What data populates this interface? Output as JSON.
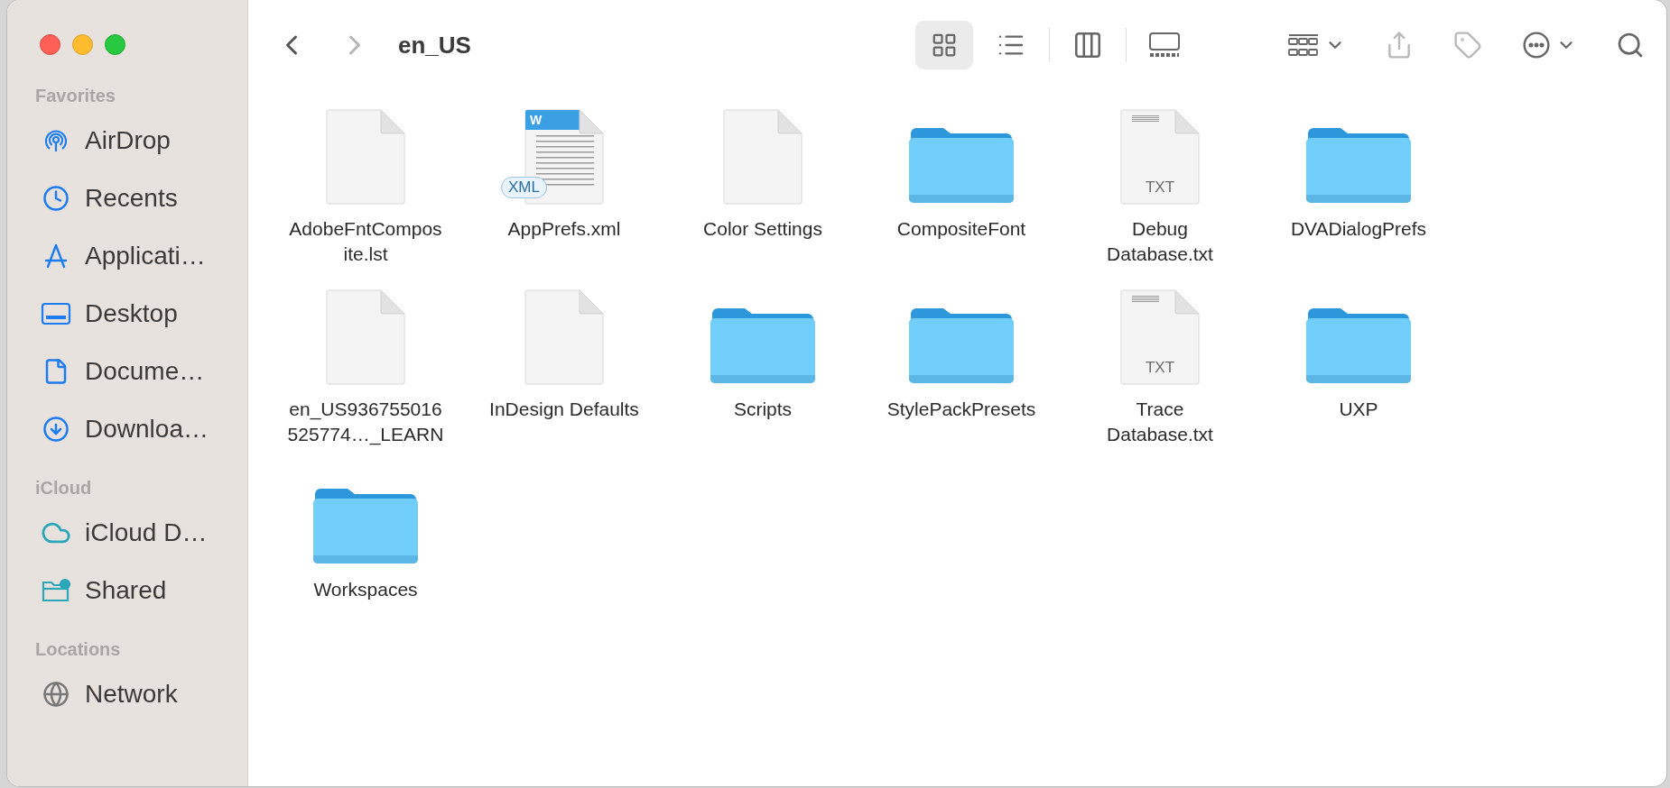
{
  "window": {
    "title": "en_US"
  },
  "toolbar": {
    "back": {
      "disabled": false
    },
    "forward": {
      "disabled": true
    },
    "view_buttons": [
      {
        "kind": "icons",
        "selected": true
      },
      {
        "kind": "list",
        "selected": false
      },
      {
        "kind": "columns",
        "selected": false
      },
      {
        "kind": "gallery",
        "selected": false
      }
    ],
    "actions": [
      {
        "kind": "group",
        "disabled": false
      },
      {
        "kind": "share",
        "disabled": true
      },
      {
        "kind": "tag",
        "disabled": true
      },
      {
        "kind": "more",
        "disabled": false
      },
      {
        "kind": "search",
        "disabled": false
      }
    ]
  },
  "sidebar": {
    "sections": [
      {
        "title": "Favorites",
        "items": [
          {
            "label": "AirDrop",
            "kind": "airdrop"
          },
          {
            "label": "Recents",
            "kind": "clock"
          },
          {
            "label": "Applicati…",
            "kind": "apps"
          },
          {
            "label": "Desktop",
            "kind": "desktop"
          },
          {
            "label": "Docume…",
            "kind": "document"
          },
          {
            "label": "Downloa…",
            "kind": "download"
          }
        ]
      },
      {
        "title": "iCloud",
        "items": [
          {
            "label": "iCloud D…",
            "kind": "cloud"
          },
          {
            "label": "Shared",
            "kind": "shared"
          }
        ]
      },
      {
        "title": "Locations",
        "items": [
          {
            "label": "Network",
            "kind": "globe"
          }
        ]
      }
    ]
  },
  "files": [
    {
      "kind": "document",
      "lines": [
        "AdobeFntCompos",
        "ite.lst"
      ]
    },
    {
      "kind": "xml",
      "badge": "XML",
      "corner_mark": "W",
      "lines": [
        "AppPrefs.xml"
      ]
    },
    {
      "kind": "document",
      "lines": [
        "Color Settings"
      ]
    },
    {
      "kind": "folder",
      "lines": [
        "CompositeFont"
      ]
    },
    {
      "kind": "txt",
      "badge": "TXT",
      "lines": [
        "Debug",
        "Database.txt"
      ]
    },
    {
      "kind": "folder",
      "lines": [
        "DVADialogPrefs"
      ]
    },
    {
      "kind": "document",
      "lines": [
        "en_US936755016",
        "525774…_LEARN"
      ]
    },
    {
      "kind": "document",
      "lines": [
        "InDesign Defaults"
      ]
    },
    {
      "kind": "folder",
      "lines": [
        "Scripts"
      ]
    },
    {
      "kind": "folder",
      "lines": [
        "StylePackPresets"
      ]
    },
    {
      "kind": "txt",
      "badge": "TXT",
      "lines": [
        "Trace",
        "Database.txt"
      ]
    },
    {
      "kind": "folder",
      "lines": [
        "UXP"
      ]
    },
    {
      "kind": "folder",
      "lines": [
        "Workspaces"
      ]
    }
  ]
}
